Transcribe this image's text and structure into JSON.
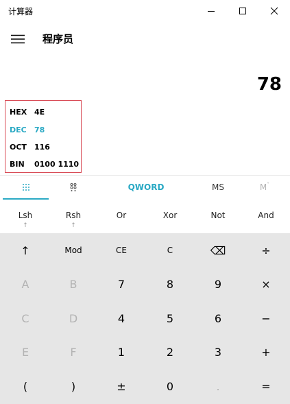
{
  "window": {
    "title": "计算器"
  },
  "header": {
    "mode_title": "程序员"
  },
  "display": {
    "value": "78"
  },
  "radix": [
    {
      "label": "HEX",
      "value": "4E",
      "active": false
    },
    {
      "label": "DEC",
      "value": "78",
      "active": true
    },
    {
      "label": "OCT",
      "value": "116",
      "active": false
    },
    {
      "label": "BIN",
      "value": "0100 1110",
      "active": false
    }
  ],
  "tabs": {
    "word_size": "QWORD",
    "memory_store": "MS",
    "memory_recall": "M"
  },
  "bit_ops": [
    {
      "name": "lsh",
      "label": "Lsh",
      "arrow": "↑"
    },
    {
      "name": "rsh",
      "label": "Rsh",
      "arrow": "↑"
    },
    {
      "name": "or",
      "label": "Or",
      "arrow": ""
    },
    {
      "name": "xor",
      "label": "Xor",
      "arrow": ""
    },
    {
      "name": "not",
      "label": "Not",
      "arrow": ""
    },
    {
      "name": "and",
      "label": "And",
      "arrow": ""
    }
  ],
  "keys": [
    [
      {
        "name": "shift",
        "label": "↑",
        "enabled": true
      },
      {
        "name": "mod",
        "label": "Mod",
        "enabled": true
      },
      {
        "name": "ce",
        "label": "CE",
        "enabled": true
      },
      {
        "name": "clear",
        "label": "C",
        "enabled": true
      },
      {
        "name": "backspace",
        "label": "⌫",
        "enabled": true
      },
      {
        "name": "divide",
        "label": "÷",
        "enabled": true
      }
    ],
    [
      {
        "name": "a",
        "label": "A",
        "enabled": false
      },
      {
        "name": "b",
        "label": "B",
        "enabled": false
      },
      {
        "name": "7",
        "label": "7",
        "enabled": true
      },
      {
        "name": "8",
        "label": "8",
        "enabled": true
      },
      {
        "name": "9",
        "label": "9",
        "enabled": true
      },
      {
        "name": "multiply",
        "label": "×",
        "enabled": true
      }
    ],
    [
      {
        "name": "c",
        "label": "C",
        "enabled": false
      },
      {
        "name": "d",
        "label": "D",
        "enabled": false
      },
      {
        "name": "4",
        "label": "4",
        "enabled": true
      },
      {
        "name": "5",
        "label": "5",
        "enabled": true
      },
      {
        "name": "6",
        "label": "6",
        "enabled": true
      },
      {
        "name": "minus",
        "label": "−",
        "enabled": true
      }
    ],
    [
      {
        "name": "e",
        "label": "E",
        "enabled": false
      },
      {
        "name": "f",
        "label": "F",
        "enabled": false
      },
      {
        "name": "1",
        "label": "1",
        "enabled": true
      },
      {
        "name": "2",
        "label": "2",
        "enabled": true
      },
      {
        "name": "3",
        "label": "3",
        "enabled": true
      },
      {
        "name": "plus",
        "label": "+",
        "enabled": true
      }
    ],
    [
      {
        "name": "open-paren",
        "label": "(",
        "enabled": true
      },
      {
        "name": "close-paren",
        "label": ")",
        "enabled": true
      },
      {
        "name": "negate",
        "label": "±",
        "enabled": true
      },
      {
        "name": "0",
        "label": "0",
        "enabled": true
      },
      {
        "name": "decimal",
        "label": ".",
        "enabled": false
      },
      {
        "name": "equals",
        "label": "=",
        "enabled": true
      }
    ]
  ],
  "colors": {
    "accent": "#2aa9c4",
    "highlight_border": "#d94c57",
    "keypad_bg": "#e6e6e6"
  }
}
